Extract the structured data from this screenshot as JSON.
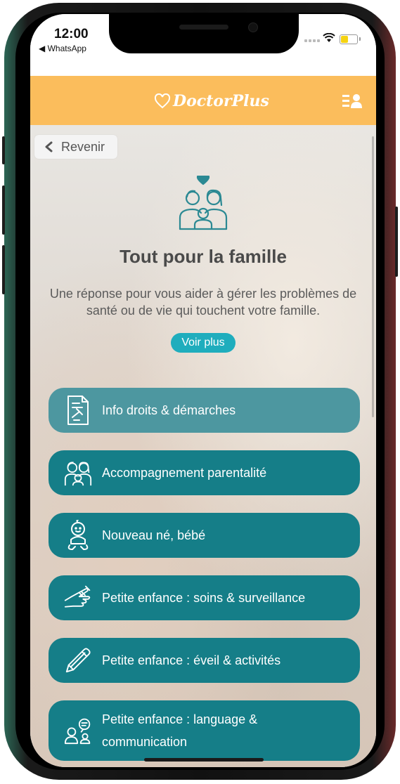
{
  "status": {
    "time": "12:00",
    "back_app": "◀ WhatsApp"
  },
  "colors": {
    "header": "#fbbd5c",
    "card": "#157e88",
    "card_active": "#4d97a0",
    "button": "#1fadbd"
  },
  "header": {
    "logo_text": "DoctorPlus",
    "logo_icon": "heart-icon",
    "menu_icon": "user-menu-icon"
  },
  "nav": {
    "back_label": "Revenir"
  },
  "hero": {
    "icon": "family-icon",
    "title": "Tout pour la famille",
    "description": "Une réponse pour vous aider à gérer les problèmes de santé ou de vie qui touchent votre famille.",
    "more_label": "Voir plus"
  },
  "menu": [
    {
      "label": "Info droits & démarches",
      "icon": "legal-document-icon"
    },
    {
      "label": "Accompagnement parentalité",
      "icon": "parents-icon"
    },
    {
      "label": "Nouveau né, bébé",
      "icon": "baby-icon"
    },
    {
      "label": "Petite enfance : soins & surveillance",
      "icon": "bandaged-hand-icon"
    },
    {
      "label": "Petite enfance : éveil & activités",
      "icon": "pencil-icon"
    },
    {
      "label": "Petite enfance : language & communication",
      "icon": "conversation-icon"
    }
  ]
}
